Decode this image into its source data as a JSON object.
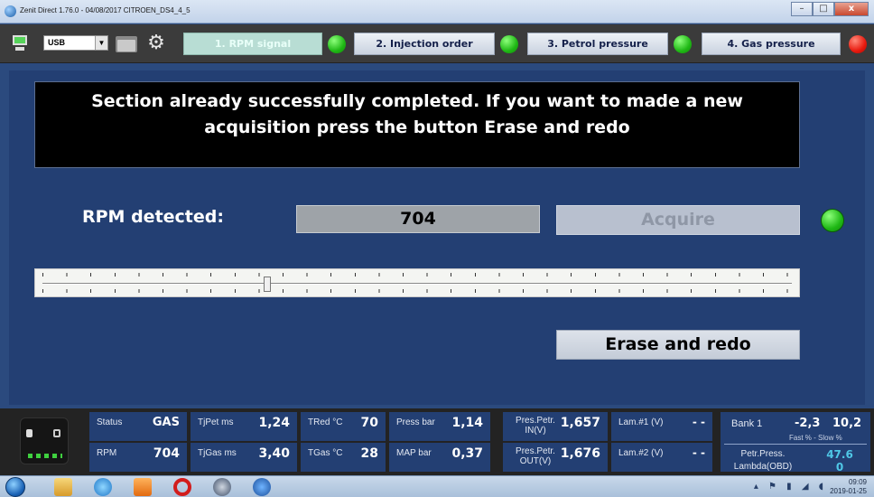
{
  "window": {
    "title": "Zenit Direct 1.76.0 - 04/08/2017   CITROEN_DS4_4_5",
    "minimize": "–",
    "maximize": "□",
    "close": "x"
  },
  "toolbar": {
    "connection": "USB",
    "tabs": [
      {
        "label": "1. RPM signal",
        "state": "active",
        "status": "green"
      },
      {
        "label": "2. Injection order",
        "state": "inactive",
        "status": "green"
      },
      {
        "label": "3. Petrol pressure",
        "state": "inactive",
        "status": "green"
      },
      {
        "label": "4. Gas pressure",
        "state": "inactive",
        "status": "red"
      }
    ]
  },
  "main": {
    "message_line1": "Section already successfully completed. If you want to made a new",
    "message_line2": "acquisition press the button Erase and redo",
    "rpm_label": "RPM detected:",
    "rpm_value": "704",
    "acquire_label": "Acquire",
    "acquire_status": "green",
    "slider_level": 0.3,
    "erase_label": "Erase and redo"
  },
  "status": {
    "status_label": "Status",
    "status_value": "GAS",
    "rpm_label": "RPM",
    "rpm_value": "704",
    "tjpet_label": "TjPet ms",
    "tjpet_value": "1,24",
    "tjgas_label": "TjGas ms",
    "tjgas_value": "3,40",
    "tred_label": "TRed °C",
    "tred_value": "70",
    "tgas_label": "TGas °C",
    "tgas_value": "28",
    "press_label": "Press bar",
    "press_value": "1,14",
    "map_label": "MAP bar",
    "map_value": "0,37",
    "prespetr_in_label": "Pres.Petr. IN(V)",
    "prespetr_in_value": "1,657",
    "prespetr_out_label": "Pres.Petr. OUT(V)",
    "prespetr_out_value": "1,676",
    "lam1_label": "Lam.#1 (V)",
    "lam1_value": "- -",
    "lam2_label": "Lam.#2 (V)",
    "lam2_value": "- -",
    "bank_label": "Bank 1",
    "bank_fast": "-2,3",
    "bank_slow": "10,2",
    "bank_sub": "Fast % - Slow %",
    "petrpress_label": "Petr.Press. Lambda(OBD)",
    "petrpress_value": "47.6",
    "lambda_value": "0"
  },
  "taskbar": {
    "time": "09:09",
    "date": "2019-01-25"
  },
  "colors": {
    "background": "#2b4a7e",
    "panel": "#233f73",
    "status_green": "#1fb815",
    "status_red": "#e81a0e",
    "value_teal": "#4fc7e6"
  }
}
